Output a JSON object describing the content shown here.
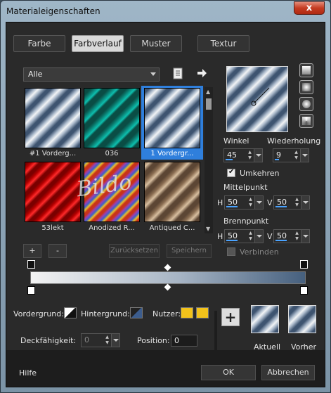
{
  "window": {
    "title": "Materialeigenschaften",
    "close_glyph": "x"
  },
  "tabs": [
    {
      "label": "Farbe",
      "active": false
    },
    {
      "label": "Farbverlauf",
      "active": true
    },
    {
      "label": "Muster",
      "active": false
    },
    {
      "label": "Textur",
      "active": false
    }
  ],
  "category": {
    "selected": "Alle"
  },
  "gradients": [
    {
      "label": "#1 Vorderg...",
      "style": "silver",
      "selected": false
    },
    {
      "label": "036",
      "style": "teal",
      "selected": false
    },
    {
      "label": "1 Vordergr...",
      "style": "silver",
      "selected": true
    },
    {
      "label": "53lekt",
      "style": "red",
      "selected": false
    },
    {
      "label": "Anodized R...",
      "style": "anodized",
      "selected": false
    },
    {
      "label": "Antiqued C...",
      "style": "antique",
      "selected": false
    }
  ],
  "watermark": "Bildo",
  "list_buttons": {
    "add": "+",
    "remove": "-",
    "reset": "Zurücksetzen",
    "save": "Speichern"
  },
  "settings": {
    "angle_label": "Winkel",
    "angle_value": "45",
    "repeat_label": "Wiederholung",
    "repeat_value": "9",
    "invert_label": "Umkehren",
    "invert_checked": true,
    "center_label": "Mittelpunkt",
    "center_h_label": "H",
    "center_h": "50",
    "center_v_label": "V",
    "center_v": "50",
    "focus_label": "Brennpunkt",
    "focus_h_label": "H",
    "focus_h": "50",
    "focus_v_label": "V",
    "focus_v": "50",
    "link_label": "Verbinden",
    "link_checked": false
  },
  "colors": {
    "foreground_label": "Vordergrund:",
    "background_label": "Hintergrund:",
    "user_label": "Nutzer:",
    "user_color": "#f2c21b",
    "opacity_label": "Deckfähigkeit:",
    "opacity_value": "0",
    "position_label": "Position:",
    "position_value": "0"
  },
  "preview": {
    "current_label": "Aktuell",
    "previous_label": "Vorher",
    "add_glyph": "+"
  },
  "footer": {
    "help": "Hilfe",
    "ok": "OK",
    "cancel": "Abbrechen"
  }
}
